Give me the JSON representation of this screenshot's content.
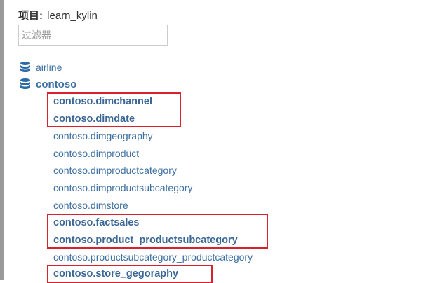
{
  "project": {
    "label": "项目:",
    "name": "learn_kylin"
  },
  "filter": {
    "placeholder": "过滤器",
    "value": ""
  },
  "databases": [
    {
      "name": "airline",
      "icon": "database-icon",
      "expanded": false
    },
    {
      "name": "contoso",
      "icon": "database-icon",
      "expanded": true
    }
  ],
  "tables": [
    {
      "name": "contoso.dimchannel",
      "highlighted": true
    },
    {
      "name": "contoso.dimdate",
      "highlighted": true
    },
    {
      "name": "contoso.dimgeography",
      "highlighted": false
    },
    {
      "name": "contoso.dimproduct",
      "highlighted": false
    },
    {
      "name": "contoso.dimproductcategory",
      "highlighted": false
    },
    {
      "name": "contoso.dimproductsubcategory",
      "highlighted": false
    },
    {
      "name": "contoso.dimstore",
      "highlighted": false
    },
    {
      "name": "contoso.factsales",
      "highlighted": true
    },
    {
      "name": "contoso.product_productsubcategory",
      "highlighted": true
    },
    {
      "name": "contoso.productsubcategory_productcategory",
      "highlighted": false
    },
    {
      "name": "contoso.store_gegoraphy",
      "highlighted": true
    }
  ],
  "colors": {
    "link": "#3c6fa2",
    "highlight": "#d8202e",
    "icon": "#2b6aa6"
  }
}
